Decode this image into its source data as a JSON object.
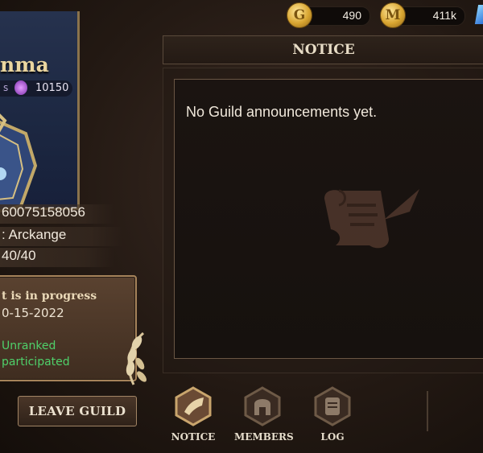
{
  "currency": {
    "gold": {
      "icon": "gold-coin-icon",
      "value": "490"
    },
    "silver": {
      "icon": "guild-coin-icon",
      "value": "411k"
    },
    "gem": {
      "icon": "blue-gem-icon"
    }
  },
  "guild": {
    "name_partial": "nma",
    "power_prefix": "s",
    "power_value": "10150",
    "id_partial": "60075158056",
    "leader_partial": ": Arckange",
    "members_partial": "40/40"
  },
  "event": {
    "title_partial": "t is in progress",
    "date_partial": "0-15-2022",
    "rank_partial": "Unranked",
    "participation_partial": " participated"
  },
  "buttons": {
    "leave_guild": "LEAVE GUILD"
  },
  "notice": {
    "header": "NOTICE",
    "message": "No Guild announcements yet."
  },
  "tabs": [
    {
      "label": "NOTICE",
      "icon": "horn-icon"
    },
    {
      "label": "MEMBERS",
      "icon": "helmet-icon"
    },
    {
      "label": "LOG",
      "icon": "scroll-icon"
    }
  ],
  "colors": {
    "accent_gold": "#a6835a",
    "positive_green": "#4fd06a",
    "banner_blue": "#1c2741"
  }
}
